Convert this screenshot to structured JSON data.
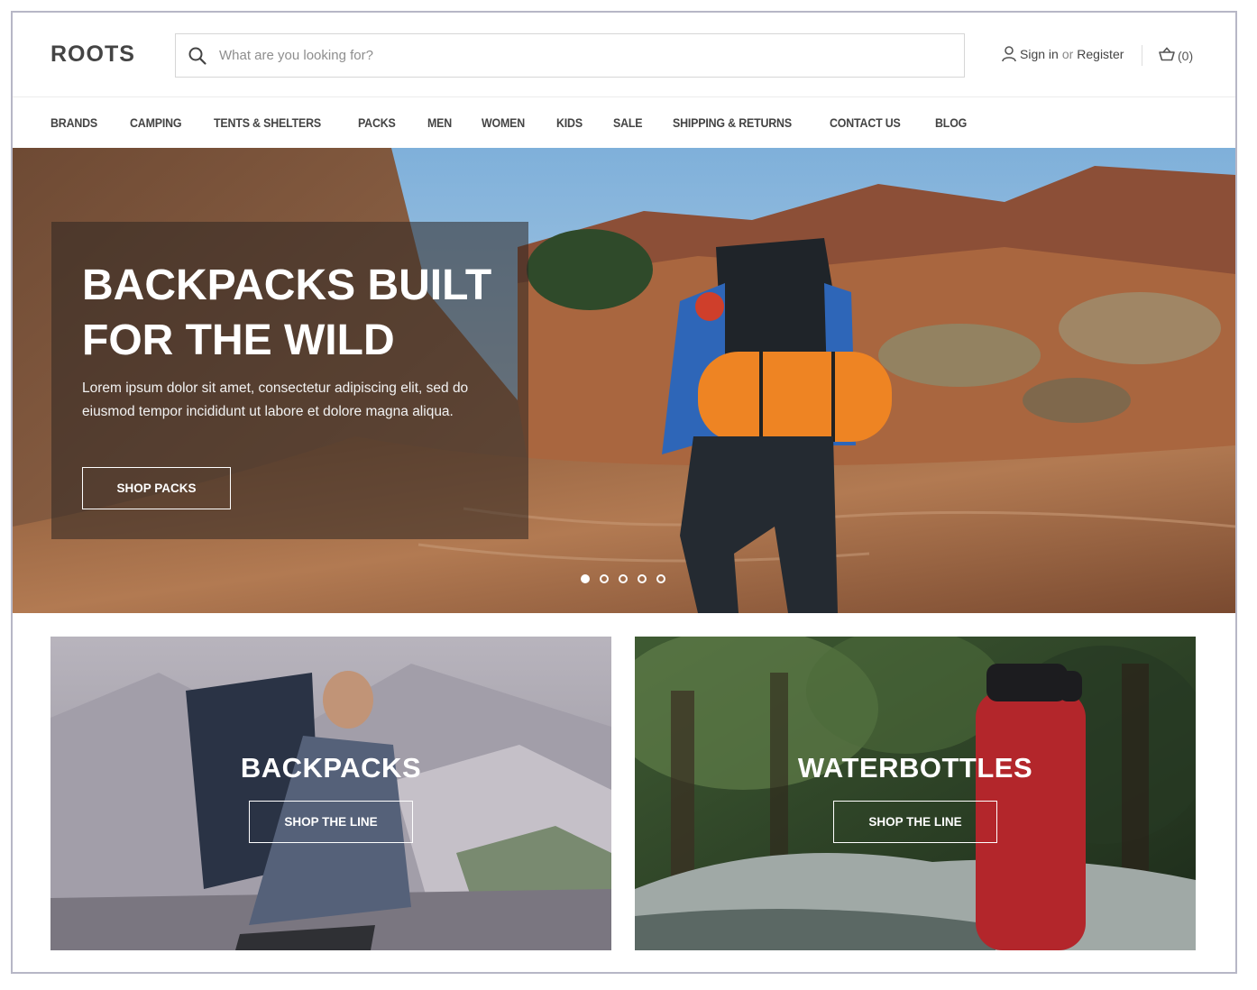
{
  "header": {
    "logo": "ROOTS",
    "search": {
      "placeholder": "What are you looking for?",
      "value": ""
    },
    "account": {
      "sign_in": "Sign in",
      "or": "or",
      "register": "Register"
    },
    "cart": {
      "label": "(0)"
    }
  },
  "nav": {
    "items": [
      "BRANDS",
      "CAMPING",
      "TENTS & SHELTERS",
      "PACKS",
      "MEN",
      "WOMEN",
      "KIDS",
      "SALE",
      "SHIPPING & RETURNS",
      "CONTACT US",
      "BLOG"
    ]
  },
  "hero": {
    "title_line1": "BACKPACKS BUILT",
    "title_line2": "FOR THE WILD",
    "text": "Lorem ipsum dolor sit amet, consectetur adipiscing elit, sed do eiusmod tempor incididunt ut labore et dolore magna aliqua.",
    "button": "SHOP PACKS",
    "slide_count": 5,
    "active_slide": 1
  },
  "tiles": [
    {
      "title": "BACKPACKS",
      "button": "SHOP THE LINE"
    },
    {
      "title": "WATERBOTTLES",
      "button": "SHOP THE LINE"
    }
  ],
  "icons": {
    "search": "search-icon",
    "user": "user-icon",
    "cart": "cart-icon"
  }
}
